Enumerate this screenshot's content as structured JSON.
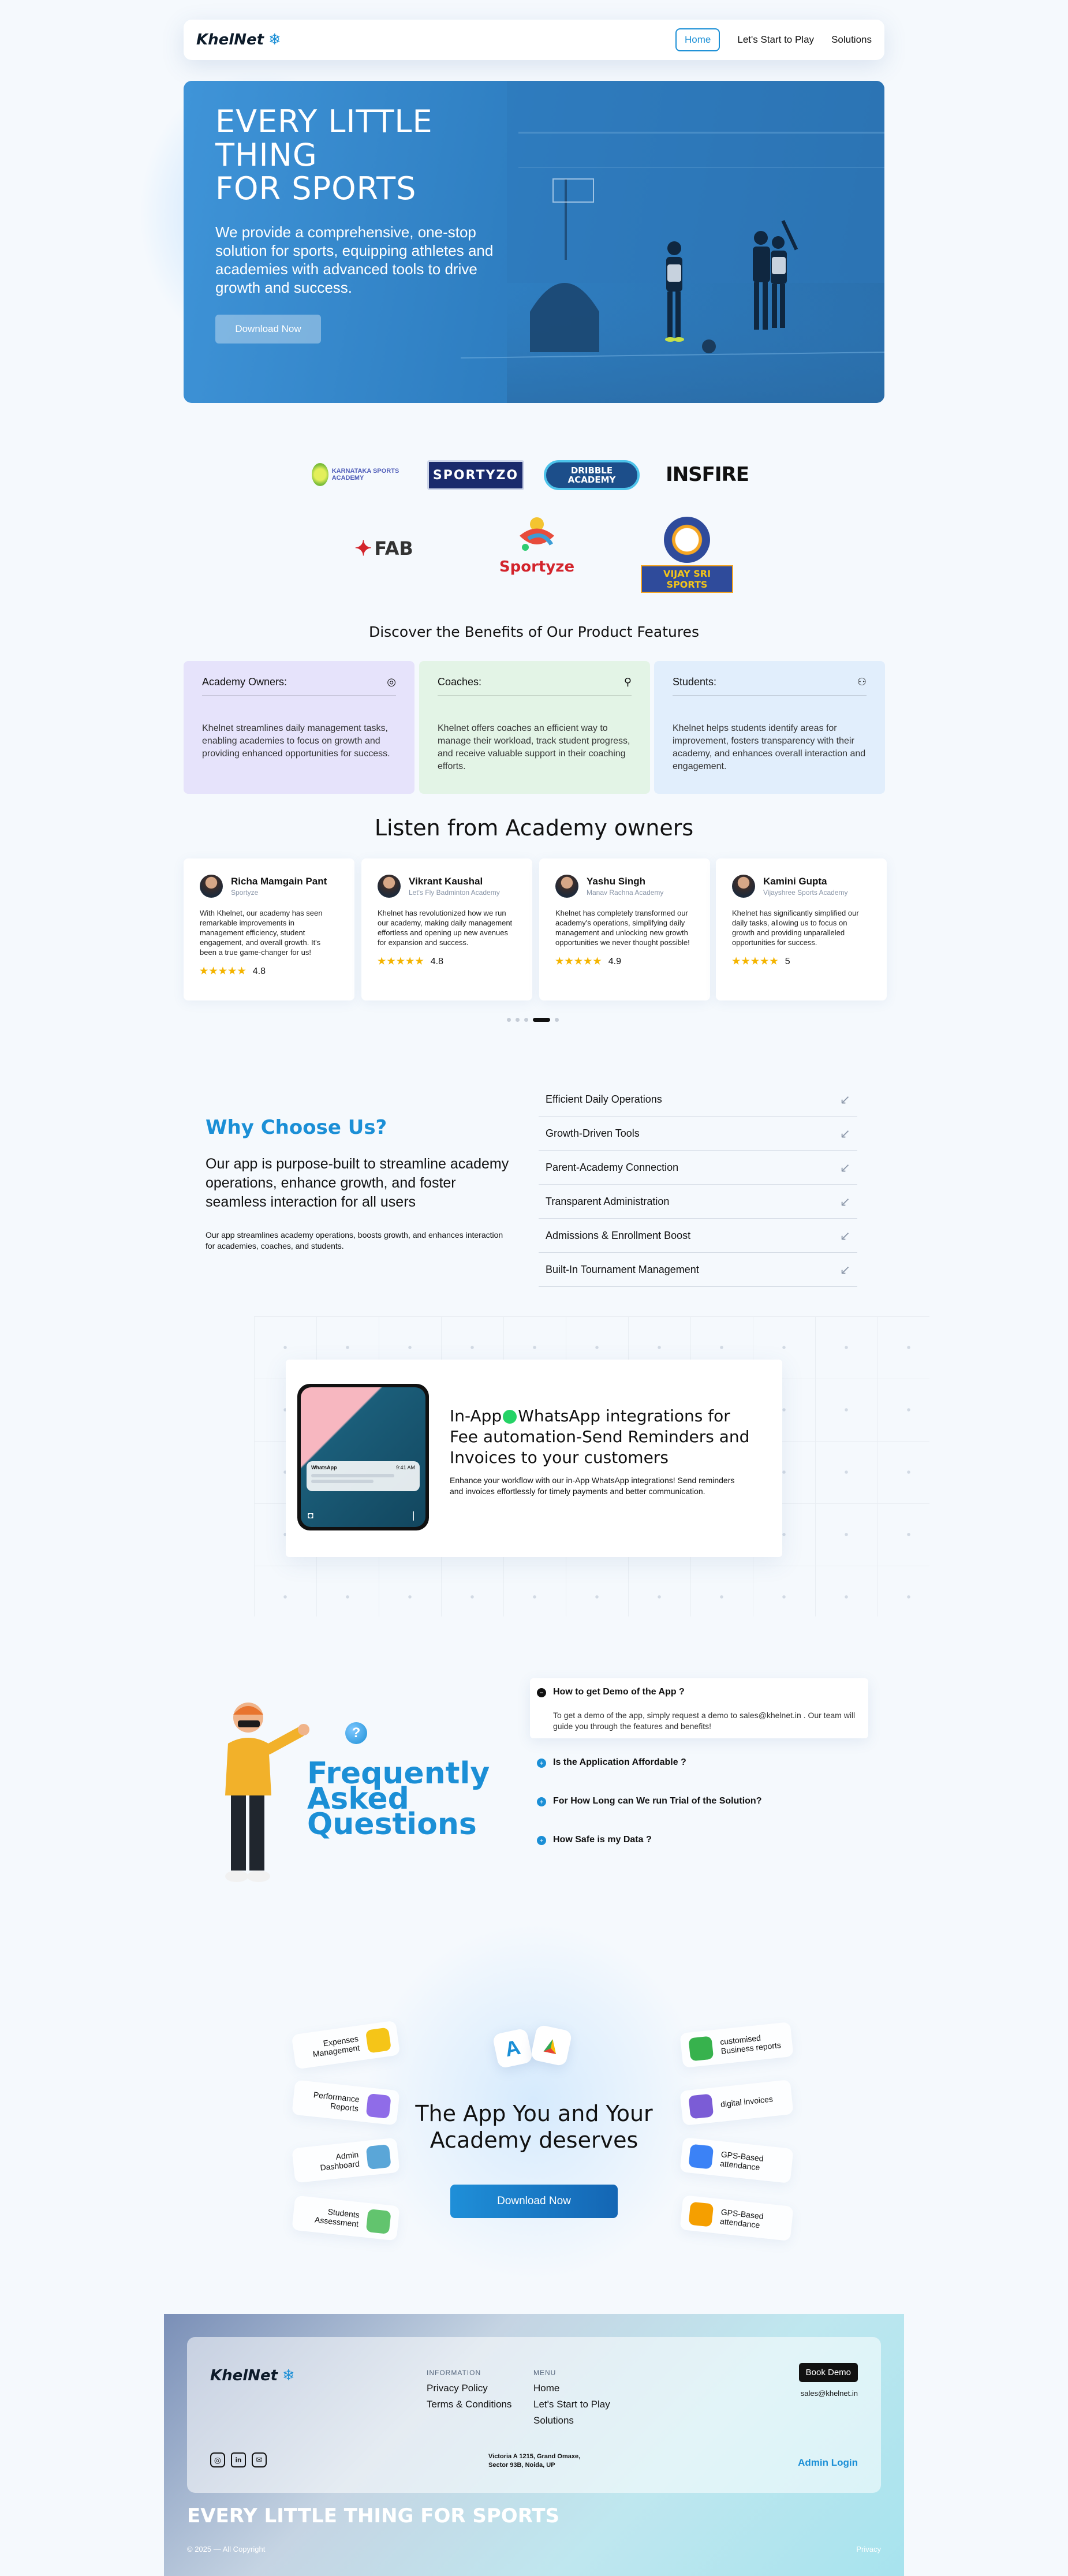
{
  "nav": {
    "brand": "KhelNet",
    "links": [
      "Home",
      "Let's Start to Play",
      "Solutions"
    ]
  },
  "hero": {
    "title_l1": "EVERY LITTLE",
    "title_l2": "THING",
    "title_l3": "FOR SPORTS",
    "subtitle": "We provide a comprehensive, one-stop solution for sports, equipping athletes and academies with advanced tools to drive growth and success.",
    "cta": "Download Now"
  },
  "partners": [
    {
      "name": "KARNATAKA SPORTS ACADEMY"
    },
    {
      "name": "SPORTYZO"
    },
    {
      "name": "DRIBBLE ACADEMY"
    },
    {
      "name": "INSFIRE"
    },
    {
      "name": "FAB"
    },
    {
      "name": "Sportyze"
    },
    {
      "name": "VIJAY SRI SPORTS"
    }
  ],
  "features": {
    "title": "Discover the Benefits of Our Product Features",
    "cards": [
      {
        "title": "Academy Owners:",
        "text": "Khelnet streamlines daily management tasks, enabling academies to focus on growth and providing enhanced opportunities for success.",
        "color": "#e6e3fb"
      },
      {
        "title": "Coaches:",
        "text": "Khelnet offers coaches an efficient way to manage their workload, track student progress, and receive valuable support in their coaching efforts.",
        "color": "#e3f4e6"
      },
      {
        "title": "Students:",
        "text": "Khelnet helps students identify areas for improvement, fosters transparency with their academy, and enhances overall interaction and engagement.",
        "color": "#e1eefc"
      }
    ]
  },
  "testimonials": {
    "title": "Listen from Academy owners",
    "items": [
      {
        "name": "Richa Mamgain Pant",
        "org": "Sportyze",
        "text": "With Khelnet, our academy has seen remarkable improvements in management efficiency, student engagement, and overall growth. It's been a true game-changer for us!",
        "rating": "4.8",
        "stars": "★★★★★"
      },
      {
        "name": "Vikrant Kaushal",
        "org": "Let's Fly Badminton Academy",
        "text": "Khelnet has revolutionized how we run our academy, making daily management effortless and opening up new avenues for expansion and success.",
        "rating": "4.8",
        "stars": "★★★★★"
      },
      {
        "name": "Yashu Singh",
        "org": "Manav Rachna Academy",
        "text": "Khelnet has completely transformed our academy's operations, simplifying daily management and unlocking new growth opportunities we never thought possible!",
        "rating": "4.9",
        "stars": "★★★★★"
      },
      {
        "name": "Kamini Gupta",
        "org": "Vijayshree Sports Academy",
        "text": "Khelnet has significantly simplified our daily tasks, allowing us to focus on growth and providing unparalleled opportunities for success.",
        "rating": "5",
        "stars": "★★★★★"
      }
    ]
  },
  "why": {
    "title": "Why Choose Us?",
    "lead": "Our app is purpose-built to streamline academy operations, enhance growth, and foster seamless interaction for all users",
    "text": "Our app streamlines academy operations, boosts growth, and enhances interaction for academies, coaches, and students.",
    "items": [
      "Efficient Daily Operations",
      "Growth-Driven Tools",
      "Parent-Academy Connection",
      "Transparent Administration",
      "Admissions & Enrollment Boost",
      "Built-In Tournament Management"
    ]
  },
  "whatsapp": {
    "title_a": "In-App",
    "title_b": "WhatsApp integrations for Fee automation-Send Reminders and Invoices to your customers",
    "text": "Enhance your workflow with our in-App WhatsApp integrations! Send reminders and invoices effortlessly for timely payments and better communication.",
    "phone_app": "WhatsApp",
    "phone_time": "9:41 AM"
  },
  "faq": {
    "title_l1": "Frequently",
    "title_l2": "Asked",
    "title_l3": "Questions",
    "items": [
      {
        "q": "How to get Demo of the App ?",
        "a": "To get a demo of the app, simply request a demo to sales@khelnet.in . Our team will guide you through the features and benefits!",
        "open": true
      },
      {
        "q": "Is the Application Affordable ?",
        "a": "",
        "open": false
      },
      {
        "q": "For How Long can We run Trial of the Solution?",
        "a": "",
        "open": false
      },
      {
        "q": "How Safe is my Data ?",
        "a": "",
        "open": false
      }
    ]
  },
  "app_cta": {
    "title_l1": "The App You and Your",
    "title_l2": "Academy deserves",
    "cta": "Download Now",
    "left": [
      {
        "label": "Expenses Management",
        "color": "#f5c518"
      },
      {
        "label": "Performance Reports",
        "color": "#8f6ce8"
      },
      {
        "label": "Admin Dashboard",
        "color": "#5aa6d8"
      },
      {
        "label": "Students Assessment",
        "color": "#62c46e"
      }
    ],
    "right": [
      {
        "label": "customised Business reports",
        "color": "#37b24d"
      },
      {
        "label": "digital invoices",
        "color": "#7b5cd6"
      },
      {
        "label": "GPS-Based attendance",
        "color": "#3b82f6"
      },
      {
        "label": "GPS-Based attendance",
        "color": "#f59f00"
      }
    ]
  },
  "footer": {
    "brand": "KhelNet",
    "info_title": "INFORMATION",
    "info_links": [
      "Privacy Policy",
      "Terms & Conditions"
    ],
    "menu_title": "MENU",
    "menu_links": [
      "Home",
      "Let's Start to Play",
      "Solutions"
    ],
    "book": "Book Demo",
    "email": "sales@khelnet.in",
    "address": "Victoria A 1215, Grand Omaxe, Sector 93B, Noida, UP",
    "admin": "Admin Login",
    "tagline": "EVERY LITTLE THING FOR SPORTS",
    "copyright": "© 2025 — All Copyright",
    "privacy": "Privacy"
  },
  "colors": {
    "accent": "#1b8fd6",
    "brand_dark": "#0d1b2a"
  }
}
